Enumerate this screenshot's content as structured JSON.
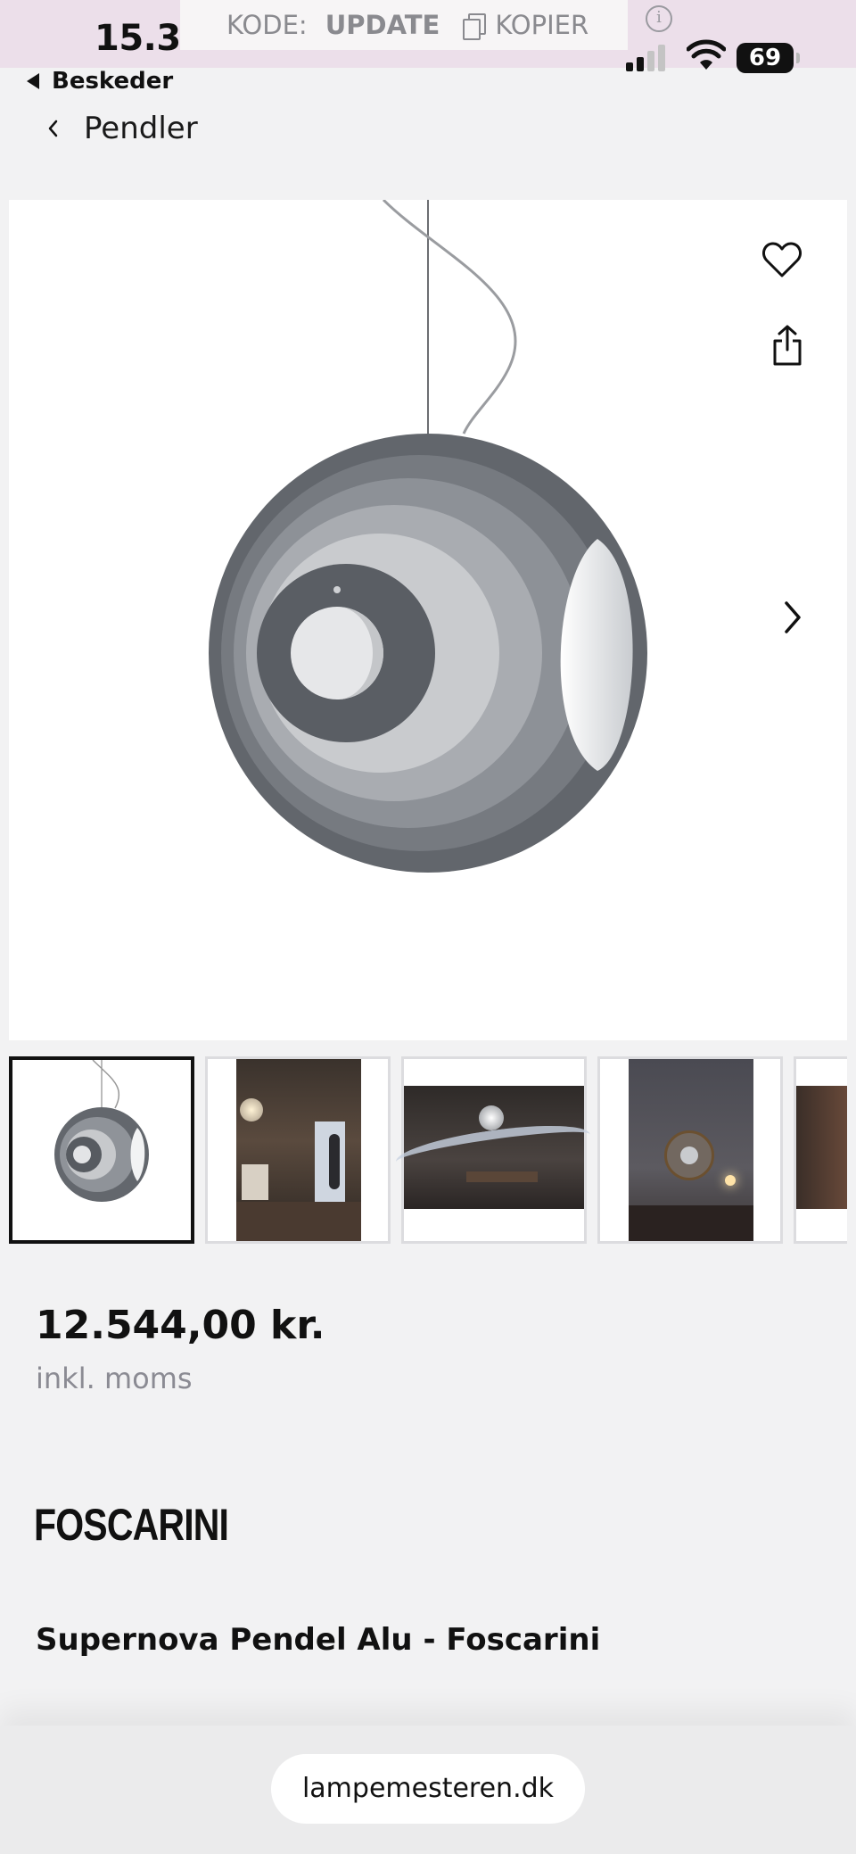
{
  "status_bar": {
    "time": "15.31",
    "battery": "69",
    "promo_code_label": "KODE:",
    "promo_code_value": "UPDATE",
    "promo_copy_label": "KOPIER"
  },
  "nav": {
    "back_app_label": "Beskeder",
    "breadcrumb_label": "Pendler"
  },
  "gallery": {
    "main_image": "supernova-pendant-product-photo",
    "thumbnails": [
      "product-photo",
      "living-room-photo",
      "light-streak-photo",
      "hallway-mirror-photo",
      "interior-photo"
    ],
    "active_index": 0
  },
  "product": {
    "price": "12.544,00 kr.",
    "vat_note": "inkl. moms",
    "brand": "FOSCARINI",
    "name": "Supernova Pendel Alu - Foscarini"
  },
  "browser": {
    "url": "lampemesteren.dk"
  },
  "icons": [
    "heart-icon",
    "share-icon",
    "chevron-right-icon",
    "chevron-left-icon",
    "info-icon",
    "copy-icon"
  ]
}
